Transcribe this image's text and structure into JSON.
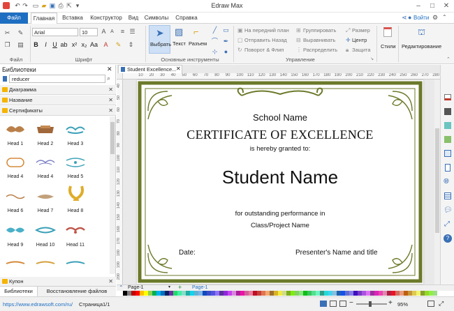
{
  "app": {
    "title": "Edraw Max"
  },
  "menu": {
    "tabs": [
      "Файл",
      "Главная",
      "Вставка",
      "Конструктор",
      "Вид",
      "Символы",
      "Справка"
    ],
    "login": "Войти"
  },
  "ribbon": {
    "font_name": "Arial",
    "font_size": "10",
    "groups": {
      "file": "Файл",
      "font": "Шрифт",
      "basic_tools": "Основные инструменты",
      "arrange": "Управление"
    },
    "tools": {
      "select": "Выбрать",
      "text": "Текст",
      "connector": "Разъем"
    },
    "arrange": {
      "bring_front": "На передний план",
      "send_back": "Отправить Назад",
      "rotate": "Поворот & Флип",
      "group": "Группировать",
      "align": "Выравнивать",
      "distribute": "Распределить",
      "size": "Размер",
      "center": "Центр",
      "protect": "Защита"
    },
    "styles": "Стили",
    "editing": "Редактирование"
  },
  "library": {
    "title": "Библиотеки",
    "search_value": "reducer",
    "sections": [
      "Диаграмма",
      "Название",
      "Сертификаты"
    ],
    "shapes": [
      "Head 1",
      "Head 2",
      "Head 3",
      "Head 4",
      "Head 4",
      "Head 5",
      "Head 6",
      "Head 7",
      "Head 8",
      "Head 9",
      "Head 10",
      "Head 11"
    ],
    "bottom_section": "Купон",
    "tabs": [
      "Библиотеки",
      "Восстановление файлов"
    ]
  },
  "document": {
    "tab_title": "Student Excellence...",
    "school": "School Name",
    "heading": "CERTIFICATE OF EXCELLENCE",
    "granted": "is hereby granted to:",
    "student": "Student Name",
    "performance": "for outstanding performance in",
    "class": "Class/Project Name",
    "date": "Date:",
    "presenter": "Presenter's Name and title",
    "ruler_top": [
      "10",
      "20",
      "30",
      "40",
      "50",
      "60",
      "70",
      "80",
      "90",
      "100",
      "110",
      "120",
      "130",
      "140",
      "150",
      "160",
      "170",
      "180",
      "190",
      "200",
      "210",
      "220",
      "230",
      "240",
      "250",
      "260",
      "270",
      "280"
    ],
    "ruler_left": [
      "40",
      "50",
      "60",
      "70",
      "80",
      "90",
      "100",
      "110",
      "120",
      "130",
      "140",
      "150",
      "160",
      "170",
      "180",
      "190",
      "200"
    ]
  },
  "pages": {
    "current": "Page-1",
    "tab": "Page-1"
  },
  "status": {
    "url": "https://www.edrawsoft.com/ru/",
    "page": "Страница1/1",
    "zoom": "95%"
  },
  "colors": {
    "accent": "#1e6fc2",
    "frame": "#6b7a2a",
    "gold": "#c4a13a"
  }
}
